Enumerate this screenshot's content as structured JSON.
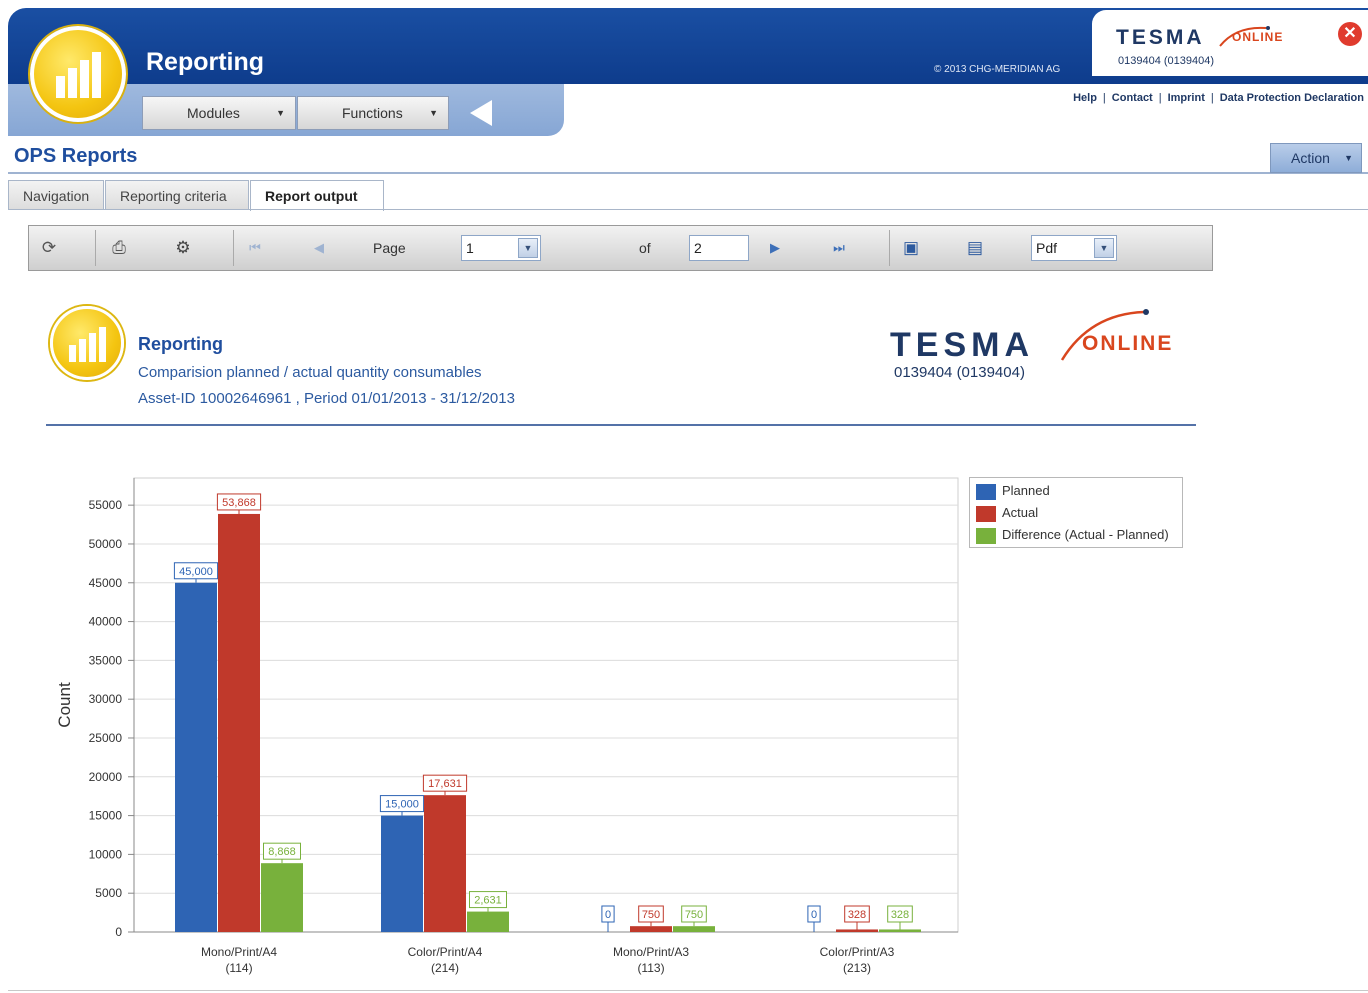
{
  "header": {
    "app_title": "Reporting",
    "copyright": "© 2013 CHG-MERIDIAN AG",
    "brand_main": "TESMA",
    "brand_sub": "ONLINE",
    "brand_id": "0139404 (0139404)",
    "menus": [
      {
        "label": "Modules"
      },
      {
        "label": "Functions"
      }
    ],
    "links": [
      "Help",
      "Contact",
      "Imprint",
      "Data Protection Declaration"
    ]
  },
  "page": {
    "title": "OPS Reports",
    "action_label": "Action"
  },
  "tabs": [
    {
      "label": "Navigation",
      "active": false
    },
    {
      "label": "Reporting criteria",
      "active": false
    },
    {
      "label": "Report output",
      "active": true
    }
  ],
  "report_toolbar": {
    "page_label": "Page",
    "page_value": "1",
    "of_label": "of",
    "total_pages": "2",
    "format": "Pdf",
    "icons": [
      "refresh-icon",
      "print-icon",
      "print-setup-icon",
      "first-page-icon",
      "previous-page-icon",
      "next-page-icon",
      "last-page-icon",
      "save-icon",
      "export-icon"
    ]
  },
  "report": {
    "title": "Reporting",
    "subtitle": "Comparision planned / actual quantity consumables",
    "details": "Asset-ID  10002646961 , Period 01/01/2013 - 31/12/2013",
    "brand_main": "TESMA",
    "brand_sub": "ONLINE",
    "brand_id": "0139404 (0139404)"
  },
  "colors": {
    "planned": "#2e64b4",
    "actual": "#c0392b",
    "difference": "#78b13c",
    "header_blue": "#0e3c8c",
    "accent_orange": "#d9461e"
  },
  "chart_data": {
    "type": "bar",
    "ylabel": "Count",
    "xlabel": "",
    "ylim": [
      0,
      55000
    ],
    "ytick_values": [
      0,
      5000,
      10000,
      15000,
      20000,
      25000,
      30000,
      35000,
      40000,
      45000,
      50000,
      55000
    ],
    "categories": [
      {
        "line1": "Mono/Print/A4",
        "line2": "(114)"
      },
      {
        "line1": "Color/Print/A4",
        "line2": "(214)"
      },
      {
        "line1": "Mono/Print/A3",
        "line2": "(113)"
      },
      {
        "line1": "Color/Print/A3",
        "line2": "(213)"
      }
    ],
    "series": [
      {
        "name": "Planned",
        "color": "#2e64b4",
        "values": [
          45000,
          15000,
          0,
          0
        ],
        "labels": [
          "45,000",
          "15,000",
          "0",
          "0"
        ]
      },
      {
        "name": "Actual",
        "color": "#c0392b",
        "values": [
          53868,
          17631,
          750,
          328
        ],
        "labels": [
          "53,868",
          "17,631",
          "750",
          "328"
        ]
      },
      {
        "name": "Difference (Actual - Planned)",
        "color": "#78b13c",
        "values": [
          8868,
          2631,
          750,
          328
        ],
        "labels": [
          "8,868",
          "2,631",
          "750",
          "328"
        ]
      }
    ],
    "grid": true,
    "legend_position": "top-right"
  }
}
